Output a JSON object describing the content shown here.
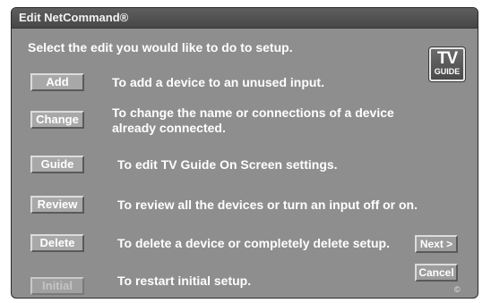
{
  "window": {
    "title": "Edit NetCommand®"
  },
  "instruction": "Select the edit you would like to do to setup.",
  "logo": {
    "line1": "TV",
    "line2": "GUIDE"
  },
  "options": [
    {
      "label": "Add",
      "description": "To add a device to an unused input.",
      "enabled": true
    },
    {
      "label": "Change",
      "description": "To change the name or connections of a device already connected.",
      "enabled": true
    },
    {
      "label": "Guide",
      "description": "To edit TV Guide On Screen settings.",
      "enabled": true
    },
    {
      "label": "Review",
      "description": "To review all the devices or turn an input off or on.",
      "enabled": true
    },
    {
      "label": "Delete",
      "description": "To delete a device or completely delete setup.",
      "enabled": true
    },
    {
      "label": "Initial",
      "description": "To restart initial setup.",
      "enabled": false
    }
  ],
  "nav": {
    "next_label": "Next >",
    "cancel_label": "Cancel"
  },
  "copyright_symbol": "©"
}
